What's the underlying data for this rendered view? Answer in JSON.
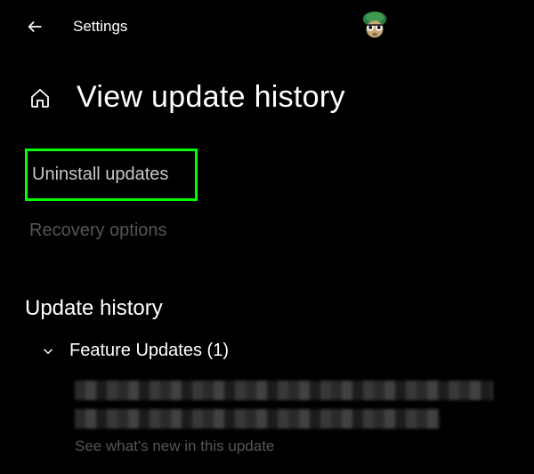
{
  "header": {
    "app_title": "Settings"
  },
  "page": {
    "title": "View update history"
  },
  "options": {
    "uninstall_label": "Uninstall updates",
    "recovery_label": "Recovery options"
  },
  "history": {
    "section_title": "Update history",
    "feature_updates_label": "Feature Updates (1)",
    "see_whats_new": "See what's new in this update"
  }
}
